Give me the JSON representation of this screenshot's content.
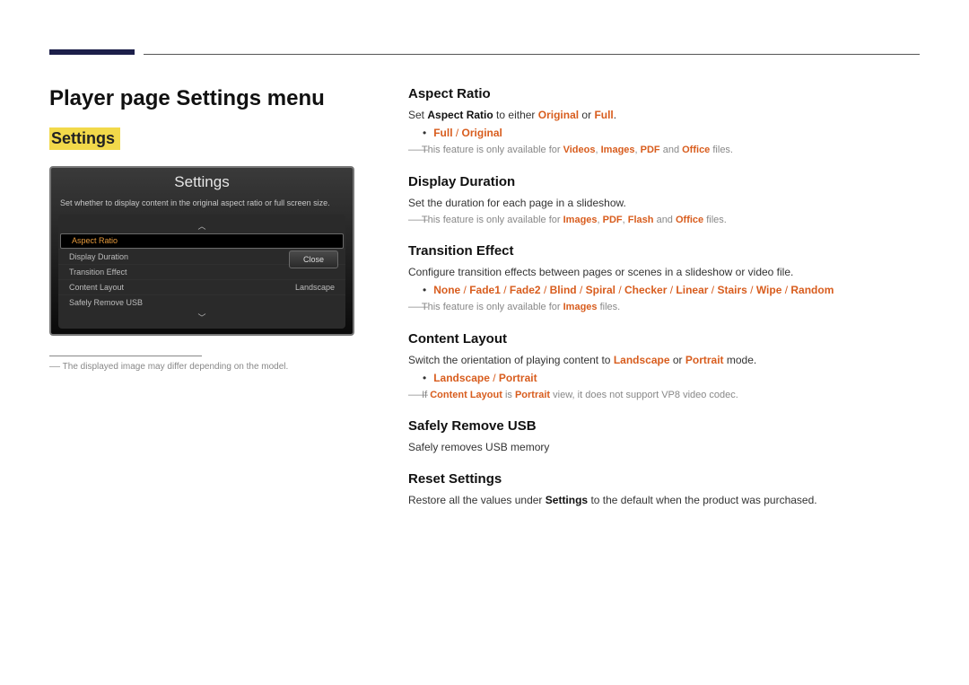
{
  "header": {
    "title": "Player page Settings menu",
    "subtitle": "Settings"
  },
  "panel": {
    "title": "Settings",
    "desc": "Set whether to display content in the original aspect ratio or full screen size.",
    "close": "Close",
    "items": [
      {
        "label": "Aspect Ratio",
        "value": ""
      },
      {
        "label": "Display Duration",
        "value": ""
      },
      {
        "label": "Transition Effect",
        "value": ""
      },
      {
        "label": "Content Layout",
        "value": "Landscape"
      },
      {
        "label": "Safely Remove USB",
        "value": ""
      }
    ],
    "footnote_dash": "――",
    "footnote": "The displayed image may differ depending on the model."
  },
  "sections": {
    "aspect": {
      "h": "Aspect Ratio",
      "p1a": "Set ",
      "p1b": "Aspect Ratio",
      "p1c": " to either ",
      "p1d": "Original",
      "p1e": " or ",
      "p1f": "Full",
      "p1g": ".",
      "opt1": "Full",
      "sep": " / ",
      "opt2": "Original",
      "note_pre": "This feature is only available for ",
      "note_v": "Videos",
      "note_i": "Images",
      "note_p": "PDF",
      "note_and": " and ",
      "note_o": "Office",
      "note_post": " files.",
      "comma": ", "
    },
    "duration": {
      "h": "Display Duration",
      "p": "Set the duration for each page in a slideshow.",
      "note_pre": "This feature is only available for ",
      "note_i": "Images",
      "note_p": "PDF",
      "note_f": "Flash",
      "note_and": " and ",
      "note_o": "Office",
      "note_post": " files.",
      "comma": ", "
    },
    "transition": {
      "h": "Transition Effect",
      "p": "Configure transition effects between pages or scenes in a slideshow or video file.",
      "opts": [
        "None",
        "Fade1",
        "Fade2",
        "Blind",
        "Spiral",
        "Checker",
        "Linear",
        "Stairs",
        "Wipe",
        "Random"
      ],
      "sep": " / ",
      "note_pre": "This feature is only available for ",
      "note_i": "Images",
      "note_post": " files."
    },
    "layout": {
      "h": "Content Layout",
      "p1a": "Switch the orientation of playing content to ",
      "p1b": "Landscape",
      "p1c": " or ",
      "p1d": "Portrait",
      "p1e": " mode.",
      "opt1": "Landscape",
      "sep": " / ",
      "opt2": "Portrait",
      "note_a": "If ",
      "note_b": "Content Layout",
      "note_c": " is ",
      "note_d": "Portrait",
      "note_e": " view, it does not support VP8 video codec."
    },
    "usb": {
      "h": "Safely Remove USB",
      "p": "Safely removes USB memory"
    },
    "reset": {
      "h": "Reset Settings",
      "p1a": "Restore all the values under ",
      "p1b": "Settings",
      "p1c": " to the default when the product was purchased."
    }
  },
  "dash": "――"
}
